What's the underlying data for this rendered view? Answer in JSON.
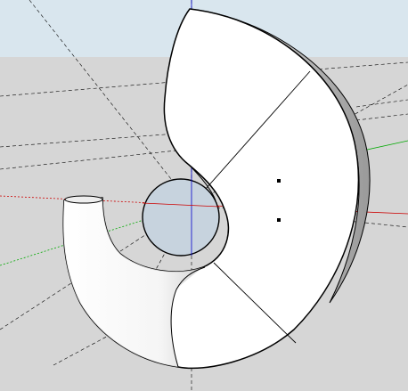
{
  "viewport": {
    "sky_color": "#d9e6ee",
    "ground_color": "#d6d6d6",
    "model_face_color": "#ffffff",
    "model_edge_color": "#000000",
    "hole_fill_color": "#c7d3de",
    "axis_colors": {
      "red": "#cc0000",
      "green": "#00aa00",
      "blue": "#0000cc"
    }
  },
  "model": {
    "description_icon": "spiral-shell-3d-model"
  }
}
